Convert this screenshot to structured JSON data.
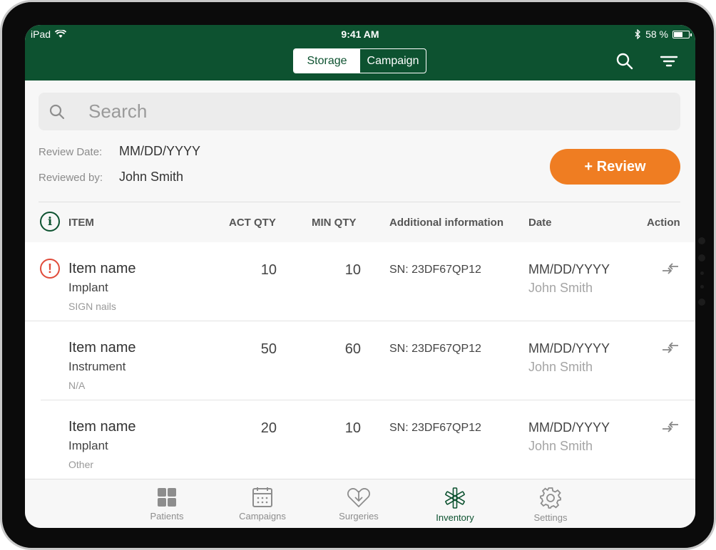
{
  "status_bar": {
    "device": "iPad",
    "time": "9:41 AM",
    "battery": "58 %"
  },
  "header": {
    "tabs": [
      {
        "label": "Storage",
        "active": true
      },
      {
        "label": "Campaign",
        "active": false
      }
    ],
    "brand_color": "#0d5230"
  },
  "search": {
    "placeholder": "Search"
  },
  "review": {
    "date_label": "Review Date:",
    "date_value": "MM/DD/YYYY",
    "by_label": "Reviewed by:",
    "by_value": "John Smith",
    "button_label": "+ Review",
    "button_color": "#ef7d22"
  },
  "table": {
    "columns": [
      "ITEM",
      "ACT QTY",
      "MIN QTY",
      "Additional information",
      "Date",
      "Action"
    ],
    "rows": [
      {
        "alert": true,
        "name": "Item name",
        "type": "Implant",
        "sub": "SIGN nails",
        "act_qty": "10",
        "min_qty": "10",
        "info": "SN: 23DF67QP12",
        "date": "MM/DD/YYYY",
        "by": "John Smith"
      },
      {
        "alert": false,
        "name": "Item name",
        "type": "Instrument",
        "sub": "N/A",
        "act_qty": "50",
        "min_qty": "60",
        "info": "SN: 23DF67QP12",
        "date": "MM/DD/YYYY",
        "by": "John Smith"
      },
      {
        "alert": false,
        "name": "Item name",
        "type": "Implant",
        "sub": "Other",
        "act_qty": "20",
        "min_qty": "10",
        "info": "SN: 23DF67QP12",
        "date": "MM/DD/YYYY",
        "by": "John Smith"
      }
    ]
  },
  "tab_bar": {
    "items": [
      {
        "label": "Patients",
        "icon": "grid-icon",
        "active": false
      },
      {
        "label": "Campaigns",
        "icon": "calendar-icon",
        "active": false
      },
      {
        "label": "Surgeries",
        "icon": "heart-download-icon",
        "active": false
      },
      {
        "label": "Inventory",
        "icon": "asterisk-icon",
        "active": true
      },
      {
        "label": "Settings",
        "icon": "gear-icon",
        "active": false
      }
    ]
  }
}
